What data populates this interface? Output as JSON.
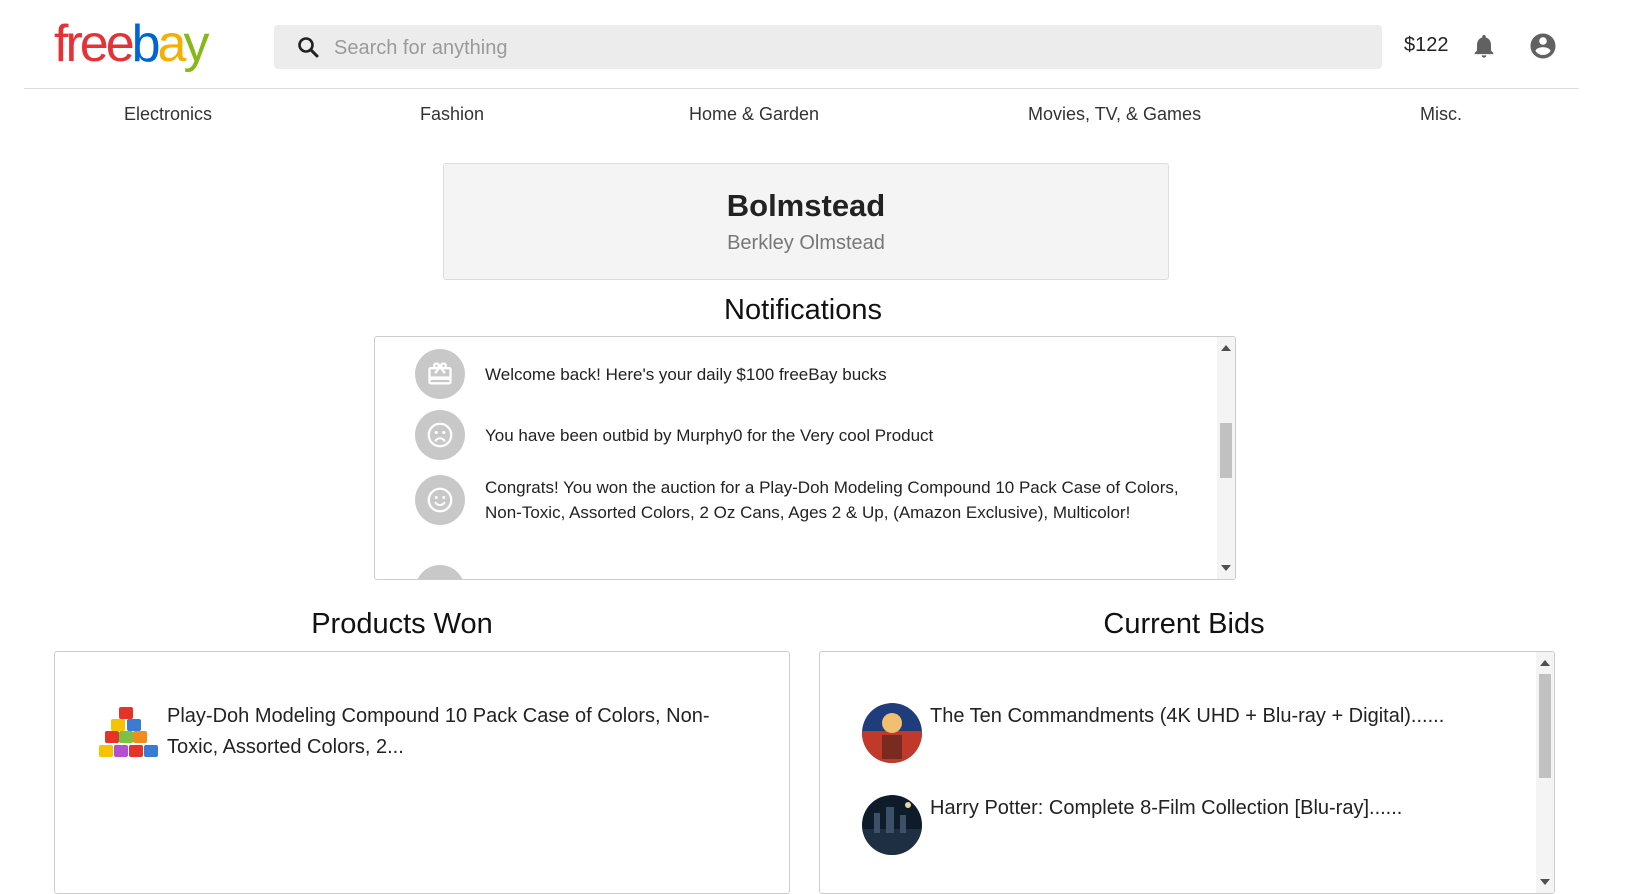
{
  "brand": {
    "letters": [
      "f",
      "r",
      "e",
      "e",
      "b",
      "a",
      "y"
    ]
  },
  "search": {
    "placeholder": "Search for anything"
  },
  "header": {
    "balance": "$122"
  },
  "nav": {
    "items": [
      "Electronics",
      "Fashion",
      "Home & Garden",
      "Movies, TV, & Games",
      "Misc."
    ]
  },
  "profile": {
    "username": "Bolmstead",
    "full_name": "Berkley Olmstead"
  },
  "notifications": {
    "title": "Notifications",
    "items": [
      {
        "icon": "gift-icon",
        "text": "Welcome back! Here's your daily $100 freeBay bucks"
      },
      {
        "icon": "sad-face-icon",
        "text": "You have been outbid by Murphy0 for the Very cool Product"
      },
      {
        "icon": "happy-face-icon",
        "text": "Congrats! You won the auction for a Play-Doh Modeling Compound 10 Pack Case of Colors, Non-Toxic, Assorted Colors, 2 Oz Cans, Ages 2 & Up, (Amazon Exclusive), Multicolor!"
      }
    ]
  },
  "products_won": {
    "title": "Products Won",
    "items": [
      {
        "title": "Play-Doh Modeling Compound 10 Pack Case of Colors, Non-Toxic, Assorted Colors, 2..."
      }
    ]
  },
  "current_bids": {
    "title": "Current Bids",
    "items": [
      {
        "title": "The Ten Commandments (4K UHD + Blu-ray + Digital)......"
      },
      {
        "title": "Harry Potter: Complete 8-Film Collection [Blu-ray]......"
      }
    ]
  },
  "colors": {
    "logo_f": "#e53238",
    "logo_r": "#e53238",
    "logo_e1": "#e53238",
    "logo_e2": "#e53238",
    "logo_b": "#0064d2",
    "logo_a": "#f5af02",
    "logo_y": "#86b817"
  }
}
